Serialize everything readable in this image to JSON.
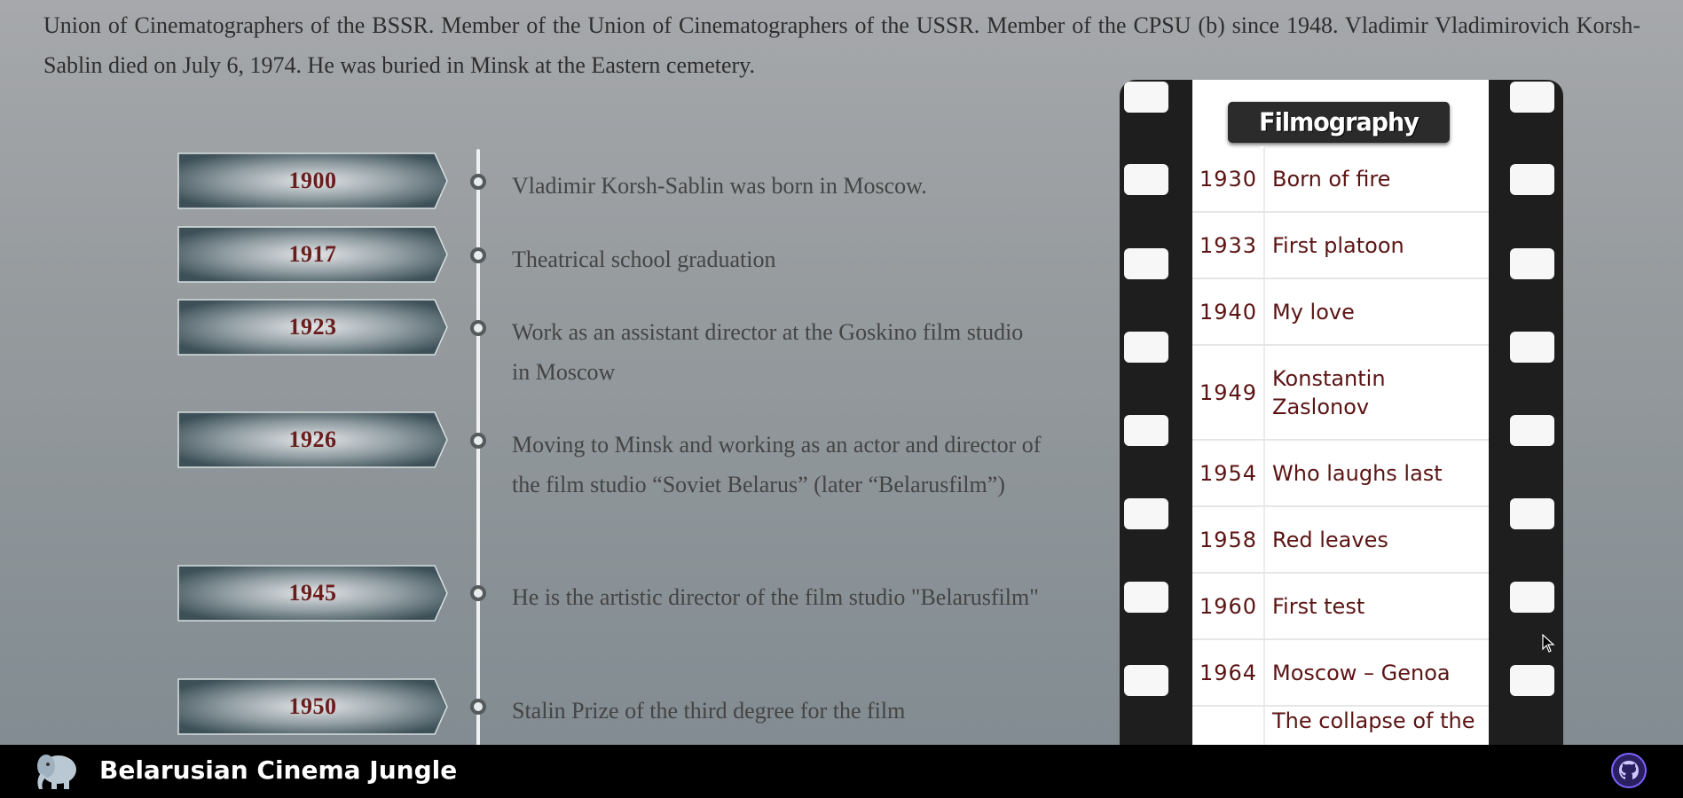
{
  "bio": {
    "line1": "Union of Cinematographers of the BSSR. Member of the Union of Cinematographers of the USSR. Member of the CPSU (b) since 1948. Vladimir Vladimirovich Korsh-Sablin died on July 6, 1974. He was buried in Minsk at the Eastern cemetery."
  },
  "timeline": [
    {
      "year": "1900",
      "text": "Vladimir Korsh-Sablin was born in Moscow."
    },
    {
      "year": "1917",
      "text": "Theatrical school graduation"
    },
    {
      "year": "1923",
      "text": "Work as an assistant director at the Goskino film studio in Moscow"
    },
    {
      "year": "1926",
      "text": "Moving to Minsk and working as an actor and director of the film studio “Soviet Belarus” (later “Belarusfilm”)"
    },
    {
      "year": "1945",
      "text": "He is the artistic director of the film studio \"Belarusfilm\""
    },
    {
      "year": "1950",
      "text": "Stalin Prize of the third degree for the film"
    }
  ],
  "filmography": {
    "title": "Filmography",
    "items": [
      {
        "year": "1930",
        "name": "Born of fire"
      },
      {
        "year": "1933",
        "name": "First platoon"
      },
      {
        "year": "1940",
        "name": "My love"
      },
      {
        "year": "1949",
        "name": "Konstantin Zaslonov"
      },
      {
        "year": "1954",
        "name": "Who laughs last"
      },
      {
        "year": "1958",
        "name": "Red leaves"
      },
      {
        "year": "1960",
        "name": "First test"
      },
      {
        "year": "1964",
        "name": "Moscow – Genoa"
      },
      {
        "year": "",
        "name": "The collapse of the"
      }
    ]
  },
  "footer": {
    "brand": "Belarusian Cinema Jungle",
    "logo_icon": "elephant-icon",
    "github_icon": "github-icon"
  }
}
